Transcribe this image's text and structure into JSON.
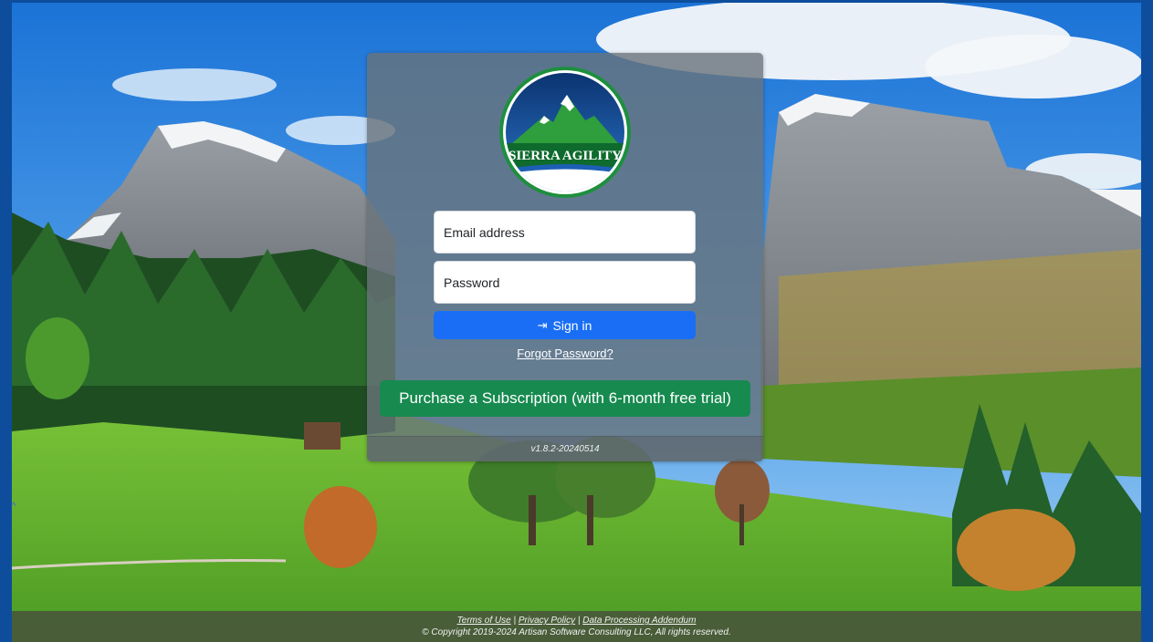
{
  "logo": {
    "text": "SIERRA AGILITY"
  },
  "form": {
    "email_placeholder": "Email address",
    "password_placeholder": "Password",
    "signin_label": "Sign in",
    "forgot_label": "Forgot Password?",
    "purchase_label": "Purchase a Subscription (with 6-month free trial)",
    "version": "v1.8.2-20240514"
  },
  "footer": {
    "terms": "Terms of Use",
    "privacy": "Privacy Policy",
    "dpa": "Data Processing Addendum",
    "separator": "|",
    "copyright": "© Copyright 2019-2024 Artisan Software Consulting LLC, All rights reserved."
  },
  "icons": {
    "signin": "sign-in-icon",
    "scroll": "chevron-up-icon"
  },
  "colors": {
    "border_blue": "#0d4d9c",
    "signin_button": "#1a6ef5",
    "purchase_button": "#178a4f"
  }
}
